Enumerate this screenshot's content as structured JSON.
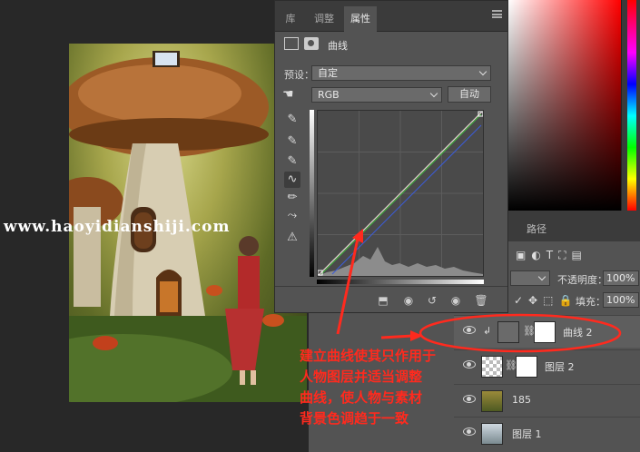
{
  "properties_panel": {
    "tabs": [
      {
        "label": "库"
      },
      {
        "label": "调整"
      },
      {
        "label": "属性"
      }
    ],
    "title": "曲线",
    "preset_label": "预设：",
    "preset_value": "自定",
    "channel_value": "RGB",
    "auto_button": "自动"
  },
  "layers_panel": {
    "tab_label": "路径",
    "opacity_label": "不透明度：",
    "opacity_value": "100%",
    "fill_label": "填充：",
    "fill_value": "100%",
    "layers": [
      {
        "name": "曲线 2"
      },
      {
        "name": "图层 2"
      },
      {
        "name": "185"
      },
      {
        "name": "图层 1"
      }
    ]
  },
  "annotation": {
    "lines": [
      "建立曲线使其只作用于",
      "人物图层并适当调整",
      "曲线，使人物与素材",
      "背景色调趋于一致"
    ]
  },
  "watermark": "www.haoyidianshiji.com",
  "colors": {
    "annotation": "#ff2a1e",
    "panel": "#535353",
    "background": "#282828"
  }
}
